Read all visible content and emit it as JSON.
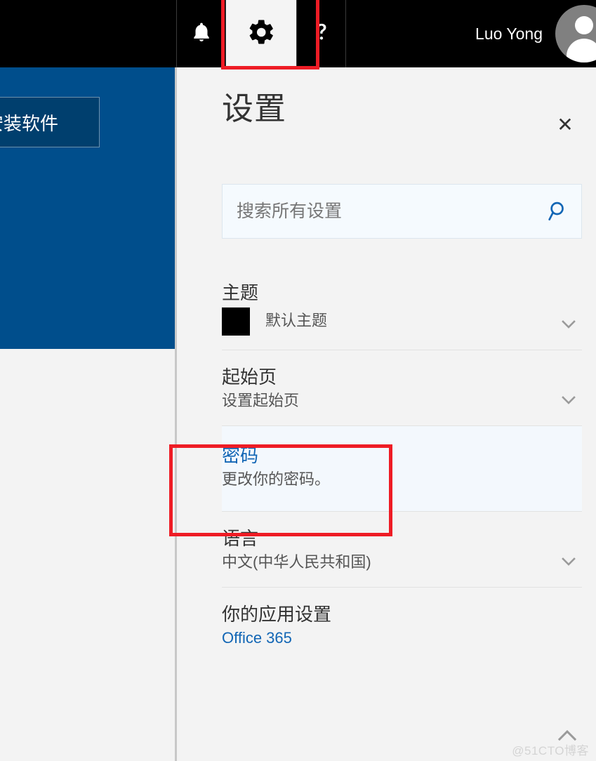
{
  "suite_bar": {
    "icons": [
      {
        "name": "bell-icon",
        "label": "通知"
      },
      {
        "name": "gear-icon",
        "label": "设置"
      },
      {
        "name": "help-icon",
        "label": "帮助"
      }
    ],
    "user_name": "Luo Yong",
    "avatar_alt": "用户头像"
  },
  "background_app": {
    "install_button_label": "安装软件"
  },
  "settings": {
    "title": "设置",
    "close_label": "✕",
    "search": {
      "placeholder": "搜索所有设置",
      "value": "",
      "icon": "search-icon"
    },
    "rows": [
      {
        "id": "theme",
        "title": "主题",
        "sub": "默认主题",
        "swatch_color": "#000000",
        "chevron": "chevron-down-icon"
      },
      {
        "id": "start-page",
        "title": "起始页",
        "sub": "设置起始页",
        "chevron": "chevron-down-icon"
      },
      {
        "id": "password",
        "title": "密码",
        "sub": "更改你的密码。",
        "highlighted": true
      },
      {
        "id": "language",
        "title": "语言",
        "sub": "中文(中华人民共和国)",
        "chevron": "chevron-down-icon"
      },
      {
        "id": "your-app-settings",
        "title": "你的应用设置",
        "sub": "Office 365",
        "sub_is_link": true
      }
    ]
  },
  "footer": {
    "scroll_top_icon": "chevron-up-icon",
    "watermark": "@51CTO博客"
  },
  "colors": {
    "suite_bar_bg": "#000000",
    "panel_bg": "#f3f3f3",
    "accent_link": "#1266b5",
    "highlight_row_bg": "#f3f8fd",
    "annotation_red": "#ee1c25",
    "left_panel_blue": "#004e8c"
  }
}
